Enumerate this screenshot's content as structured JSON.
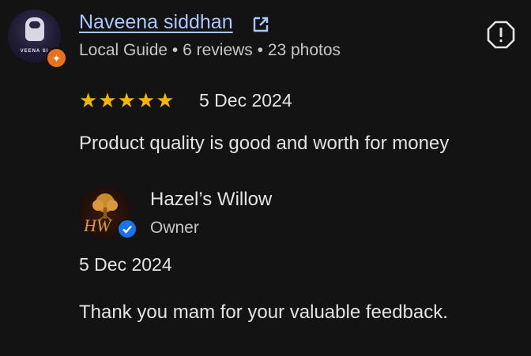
{
  "review": {
    "reviewer": {
      "name": "Naveena siddhan",
      "avatar_text": "VEENA SI",
      "meta": "Local Guide • 6 reviews • 23 photos",
      "badge_icon": "local-guide-star"
    },
    "rating": 5,
    "rating_max": 5,
    "stars": [
      "★",
      "★",
      "★",
      "★",
      "★"
    ],
    "date": "5 Dec 2024",
    "text": "Product quality is good and worth for money",
    "star_color": "#f6b400",
    "link_color": "#a8c7fa"
  },
  "owner_reply": {
    "name": "Hazel’s Willow",
    "role": "Owner",
    "avatar_monogram": "HW",
    "date": "5 Dec 2024",
    "text": "Thank you mam for your valuable feedback.",
    "verified_color": "#1a73e8"
  }
}
